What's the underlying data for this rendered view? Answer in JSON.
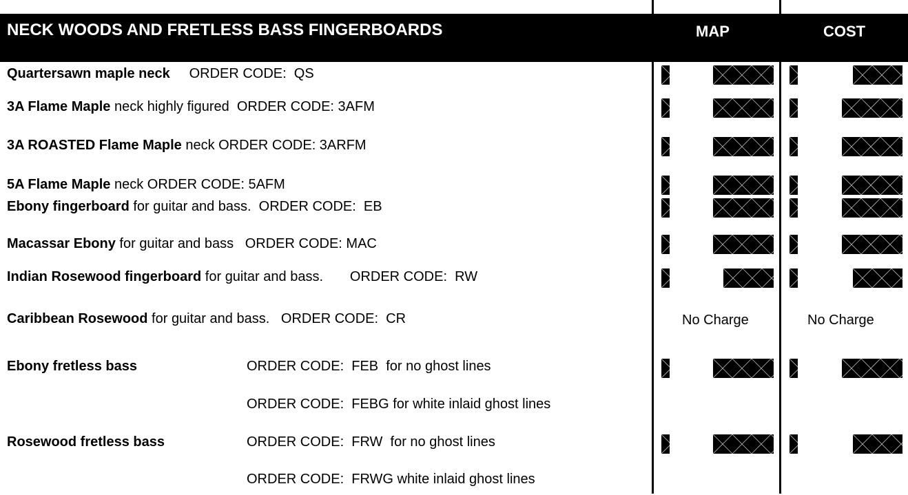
{
  "header": {
    "title": "NECK WOODS AND FRETLESS BASS FINGERBOARDS",
    "map_label": "MAP",
    "cost_label": "COST"
  },
  "rows": [
    {
      "bold": "Quartersawn maple neck",
      "rest": "     ORDER CODE:  QS",
      "map": "redacted",
      "cost": "redacted"
    },
    {
      "bold": "3A Flame Maple",
      "rest": " neck highly figured  ORDER CODE: 3AFM",
      "map": "redacted",
      "cost": "redacted"
    },
    {
      "bold": "3A ROASTED Flame Maple",
      "rest": " neck ORDER CODE: 3ARFM",
      "map": "redacted",
      "cost": "redacted"
    },
    {
      "bold": "5A Flame Maple",
      "rest": " neck ORDER CODE: 5AFM",
      "map": "redacted",
      "cost": "redacted"
    },
    {
      "bold": "Ebony fingerboard",
      "rest": " for guitar and bass.  ORDER CODE:  EB",
      "map": "redacted",
      "cost": "redacted"
    },
    {
      "bold": "Macassar Ebony",
      "rest": " for guitar and bass   ORDER CODE: MAC",
      "map": "redacted",
      "cost": "redacted"
    },
    {
      "bold": "Indian Rosewood fingerboard",
      "rest": " for guitar and bass.       ORDER CODE:  RW",
      "map": "redacted",
      "cost": "redacted"
    },
    {
      "bold": "Caribbean Rosewood",
      "rest": " for guitar and bass.   ORDER CODE:  CR",
      "map": "No Charge",
      "cost": "No Charge"
    },
    {
      "bold": "Ebony fretless bass",
      "code": "ORDER CODE:  FEB  for no ghost lines",
      "map": "redacted",
      "cost": "redacted"
    },
    {
      "bold": "",
      "code": "ORDER CODE:  FEBG for white inlaid ghost lines",
      "map": "",
      "cost": ""
    },
    {
      "bold": "Rosewood fretless bass",
      "code": "ORDER CODE:  FRW  for no ghost lines",
      "map": "redacted",
      "cost": "redacted"
    },
    {
      "bold": "",
      "code": "ORDER CODE:  FRWG white inlaid ghost lines",
      "map": "",
      "cost": ""
    }
  ]
}
